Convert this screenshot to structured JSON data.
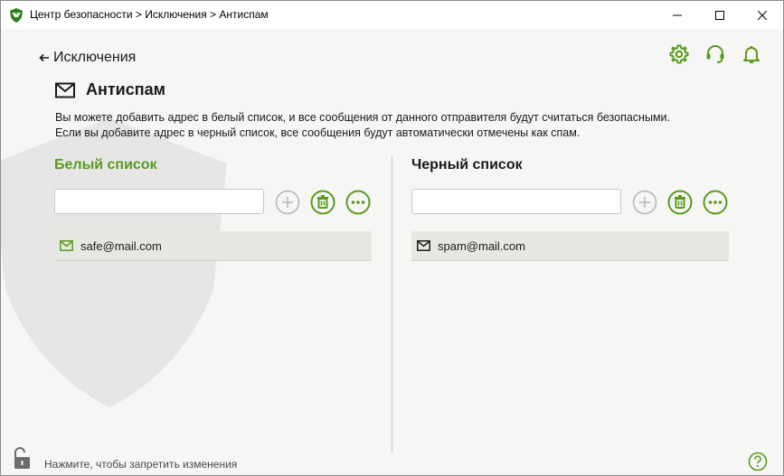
{
  "window": {
    "title": "Центр безопасности > Исключения > Антиспам"
  },
  "header": {
    "back_label": "Исключения",
    "page_title": "Антиспам",
    "description_line1": "Вы можете добавить адрес в белый список, и все сообщения от данного отправителя будут считаться безопасными.",
    "description_line2": "Если вы добавите адрес в черный список, все сообщения будут автоматически отмечены как спам."
  },
  "icons": {
    "settings": "gear-icon",
    "support": "headset-icon",
    "notifications": "bell-icon"
  },
  "whitelist": {
    "title": "Белый список",
    "input_value": "",
    "items": [
      "safe@mail.com"
    ]
  },
  "blacklist": {
    "title": "Черный список",
    "input_value": "",
    "items": [
      "spam@mail.com"
    ]
  },
  "footer": {
    "lock_text": "Нажмите, чтобы запретить изменения"
  },
  "colors": {
    "accent": "#5a9a1e",
    "disabled": "#b5b5b5"
  }
}
